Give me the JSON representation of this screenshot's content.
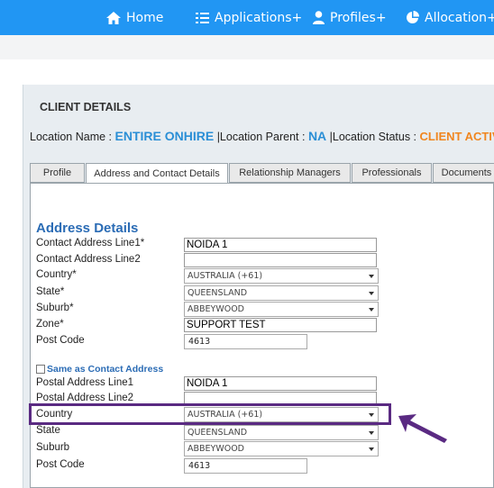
{
  "nav": {
    "home": "Home",
    "applications": "Applications+",
    "profiles": "Profiles+",
    "allocation": "Allocation+"
  },
  "client": {
    "title": "CLIENT DETAILS",
    "location_name_label": "Location Name :",
    "location_name": "ENTIRE ONHIRE",
    "location_parent_label": "|Location Parent :",
    "location_parent": "NA",
    "location_status_label": "|Location Status :",
    "location_status": "CLIENT ACTIVE"
  },
  "tabs": [
    "Profile",
    "Address and Contact Details",
    "Relationship Managers",
    "Professionals",
    "Documents"
  ],
  "address": {
    "section_title": "Address Details",
    "contact_line1_label": "Contact Address Line1*",
    "contact_line1_value": "NOIDA 1",
    "contact_line2_label": "Contact Address Line2",
    "contact_line2_value": "",
    "country_label": "Country*",
    "country_value": "AUSTRALIA (+61)",
    "state_label": "State*",
    "state_value": "QUEENSLAND",
    "suburb_label": "Suburb*",
    "suburb_value": "ABBEYWOOD",
    "zone_label": "Zone*",
    "zone_value": "SUPPORT TEST",
    "postcode_label": "Post Code",
    "postcode_value": "4613"
  },
  "postal": {
    "same_as_label": "Same as Contact Address",
    "line1_label": "Postal Address Line1",
    "line1_value": "NOIDA 1",
    "line2_label": "Postal Address Line2",
    "line2_value": "",
    "country_label": "Country",
    "country_value": "AUSTRALIA (+61)",
    "state_label": "State",
    "state_value": "QUEENSLAND",
    "suburb_label": "Suburb",
    "suburb_value": "ABBEYWOOD",
    "postcode_label": "Post Code",
    "postcode_value": "4613"
  },
  "colors": {
    "nav": "#2196f3",
    "link_blue": "#2b8fd6",
    "status_orange": "#f0861f",
    "highlight": "#5a2a82"
  }
}
